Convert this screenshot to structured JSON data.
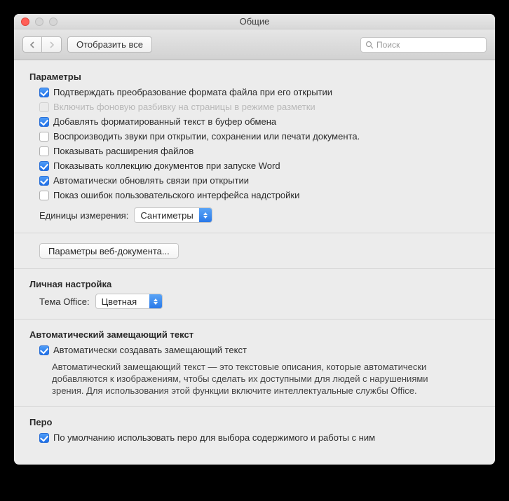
{
  "window": {
    "title": "Общие"
  },
  "toolbar": {
    "show_all": "Отобразить все",
    "search_placeholder": "Поиск"
  },
  "sections": {
    "params": {
      "title": "Параметры",
      "items": [
        {
          "label": "Подтверждать преобразование формата файла при его открытии",
          "checked": true,
          "disabled": false
        },
        {
          "label": "Включить фоновую разбивку на страницы в режиме разметки",
          "checked": false,
          "disabled": true
        },
        {
          "label": "Добавлять форматированный текст в буфер обмена",
          "checked": true,
          "disabled": false
        },
        {
          "label": "Воспроизводить звуки при открытии, сохранении или печати документа.",
          "checked": false,
          "disabled": false
        },
        {
          "label": "Показывать расширения файлов",
          "checked": false,
          "disabled": false
        },
        {
          "label": "Показывать коллекцию документов при запуске Word",
          "checked": true,
          "disabled": false
        },
        {
          "label": "Автоматически обновлять связи при открытии",
          "checked": true,
          "disabled": false
        },
        {
          "label": "Показ ошибок пользовательского интерфейса надстройки",
          "checked": false,
          "disabled": false
        }
      ],
      "units_label": "Единицы измерения:",
      "units_value": "Сантиметры",
      "webopts_button": "Параметры веб-документа..."
    },
    "personal": {
      "title": "Личная настройка",
      "theme_label": "Тема Office:",
      "theme_value": "Цветная"
    },
    "alttext": {
      "title": "Автоматический замещающий текст",
      "checkbox_label": "Автоматически создавать замещающий текст",
      "checked": true,
      "description": "Автоматический замещающий текст — это текстовые описания, которые автоматически добавляются к изображениям, чтобы сделать их доступными для людей с нарушениями зрения. Для использования этой функции включите интеллектуальные службы Office."
    },
    "pen": {
      "title": "Перо",
      "checkbox_label": "По умолчанию использовать перо для выбора содержимого и работы с ним",
      "checked": true
    }
  }
}
